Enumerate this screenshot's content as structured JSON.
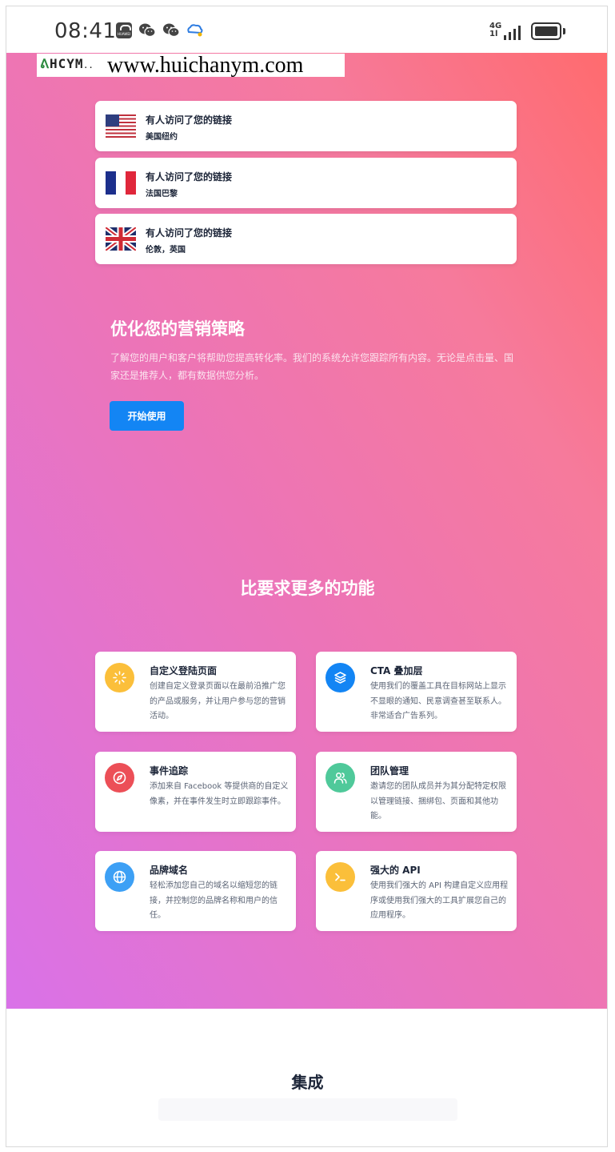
{
  "status_bar": {
    "time": "08:41",
    "network": [
      "4G",
      "1l"
    ],
    "icons": [
      "huawei-appgallery-icon",
      "wechat-icon",
      "wechat-icon",
      "cloud-icon",
      "signal-icon",
      "battery-icon"
    ],
    "huawei_text": "HUAWEI"
  },
  "watermark": {
    "logo": "HCYM",
    "url": "www.huichanym.com"
  },
  "visits": [
    {
      "title": "有人访问了您的链接",
      "location": "美国纽约",
      "flag": "us-flag-icon"
    },
    {
      "title": "有人访问了您的链接",
      "location": "法国巴黎",
      "flag": "france-flag-icon"
    },
    {
      "title": "有人访问了您的链接",
      "location": "伦敦，英国",
      "flag": "uk-flag-icon"
    }
  ],
  "optimize": {
    "heading": "优化您的营销策略",
    "body": "了解您的用户和客户将帮助您提高转化率。我们的系统允许您跟踪所有内容。无论是点击量、国家还是推荐人，都有数据供您分析。",
    "button": "开始使用"
  },
  "features_heading": "比要求更多的功能",
  "features": [
    {
      "title": "自定义登陆页面",
      "desc": "创建自定义登录页面以在最前沿推广您的产品或服务，并让用户参与您的营销活动。",
      "icon": "loader-icon",
      "color": "#fbbf3a"
    },
    {
      "title": "CTA 叠加层",
      "desc": "使用我们的覆盖工具在目标网站上显示不显眼的通知、民意调查甚至联系人。非常适合广告系列。",
      "icon": "layers-icon",
      "color": "#1385f4"
    },
    {
      "title": "事件追踪",
      "desc": "添加来自 Facebook 等提供商的自定义像素，并在事件发生时立即跟踪事件。",
      "icon": "compass-icon",
      "color": "#ec4f57"
    },
    {
      "title": "团队管理",
      "desc": "邀请您的团队成员并为其分配特定权限以管理链接、捆绑包、页面和其他功能。",
      "icon": "users-icon",
      "color": "#4fc99a"
    },
    {
      "title": "品牌域名",
      "desc": "轻松添加您自己的域名以缩短您的链接，并控制您的品牌名称和用户的信任。",
      "icon": "globe-icon",
      "color": "#3da0f5"
    },
    {
      "title": "强大的 API",
      "desc": "使用我们强大的 API 构建自定义应用程序或使用我们强大的工具扩展您自己的应用程序。",
      "icon": "terminal-icon",
      "color": "#fbbf3a"
    }
  ],
  "integration_heading": "集成"
}
